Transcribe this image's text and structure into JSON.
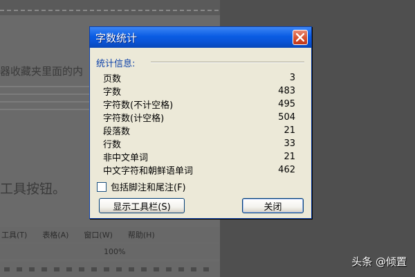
{
  "background": {
    "heading1": "器收藏夹里面的内",
    "heading2": "工具按钮。",
    "menu_items": [
      "工具(T)",
      "表格(A)",
      "窗口(W)",
      "帮助(H)"
    ],
    "zoom": "100%"
  },
  "dialog": {
    "title": "字数统计",
    "group_label": "统计信息:",
    "stats": [
      {
        "label": "页数",
        "value": "3"
      },
      {
        "label": "字数",
        "value": "483"
      },
      {
        "label": "字符数(不计空格)",
        "value": "495"
      },
      {
        "label": "字符数(计空格)",
        "value": "504"
      },
      {
        "label": "段落数",
        "value": "21"
      },
      {
        "label": "行数",
        "value": "33"
      },
      {
        "label": "非中文单词",
        "value": "21"
      },
      {
        "label": "中文字符和朝鲜语单词",
        "value": "462"
      }
    ],
    "checkbox_label": "包括脚注和尾注(F)",
    "checkbox_checked": false,
    "toolbar_button": "显示工具栏(S)",
    "close_button": "关闭"
  },
  "watermark": "头条 @倾置",
  "colors": {
    "titlebar": "#0a5ce3",
    "dialog_bg": "#ece9d8",
    "group_label": "#0a3fa8",
    "close_button": "#d6512f"
  }
}
